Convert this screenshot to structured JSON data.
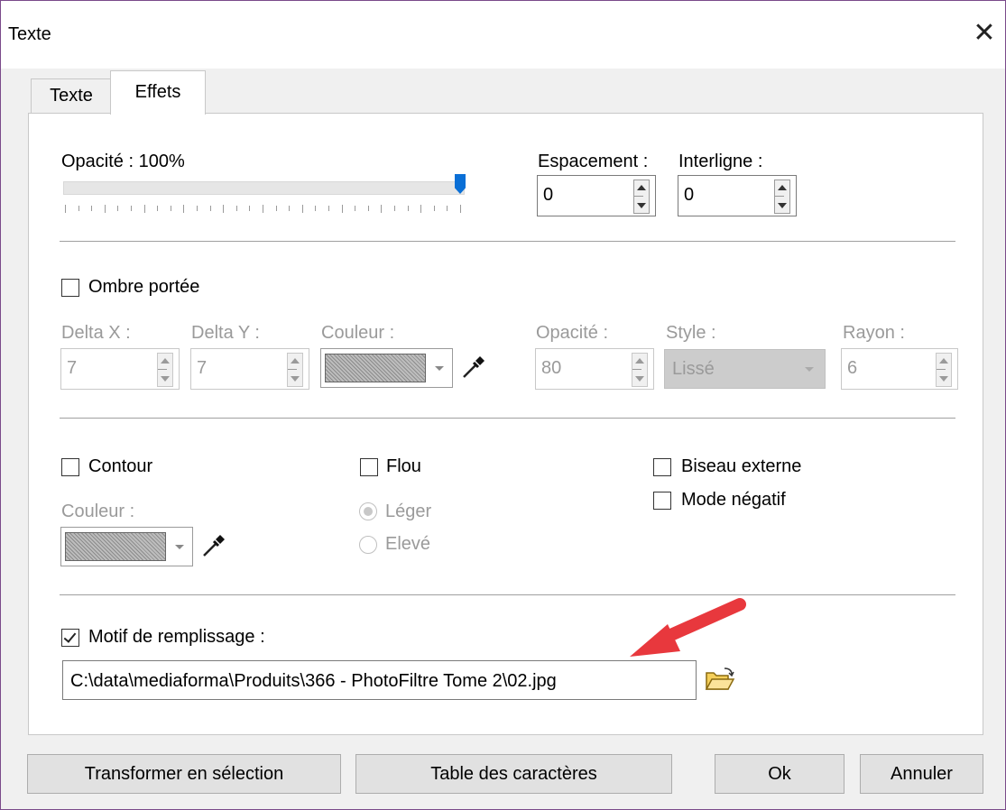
{
  "window": {
    "title": "Texte"
  },
  "tabs": [
    {
      "label": "Texte",
      "active": false
    },
    {
      "label": "Effets",
      "active": true
    }
  ],
  "opacity": {
    "label": "Opacité : 100%",
    "value": 100
  },
  "espacement": {
    "label": "Espacement :",
    "value": "0"
  },
  "interligne": {
    "label": "Interligne :",
    "value": "0"
  },
  "ombre": {
    "checkbox_label": "Ombre portée",
    "checked": false,
    "delta_x": {
      "label": "Delta X :",
      "value": "7"
    },
    "delta_y": {
      "label": "Delta Y :",
      "value": "7"
    },
    "couleur_label": "Couleur :",
    "opacite": {
      "label": "Opacité :",
      "value": "80"
    },
    "style": {
      "label": "Style :",
      "value": "Lissé"
    },
    "rayon": {
      "label": "Rayon :",
      "value": "6"
    }
  },
  "contour": {
    "checkbox_label": "Contour",
    "checked": false,
    "couleur_label": "Couleur :"
  },
  "flou": {
    "checkbox_label": "Flou",
    "checked": false,
    "options": [
      "Léger",
      "Elevé"
    ],
    "selected": "Léger"
  },
  "biseau": {
    "checkbox_label": "Biseau externe",
    "checked": false
  },
  "negatif": {
    "checkbox_label": "Mode négatif",
    "checked": false
  },
  "motif": {
    "checkbox_label": "Motif de remplissage :",
    "checked": true,
    "path": "C:\\data\\mediaforma\\Produits\\366 - PhotoFiltre Tome 2\\02.jpg"
  },
  "buttons": {
    "transformer": "Transformer en sélection",
    "table": "Table des caractères",
    "ok": "Ok",
    "annuler": "Annuler"
  },
  "colors": {
    "arrow": "#e8383d",
    "slider_thumb": "#0a6fd6"
  }
}
